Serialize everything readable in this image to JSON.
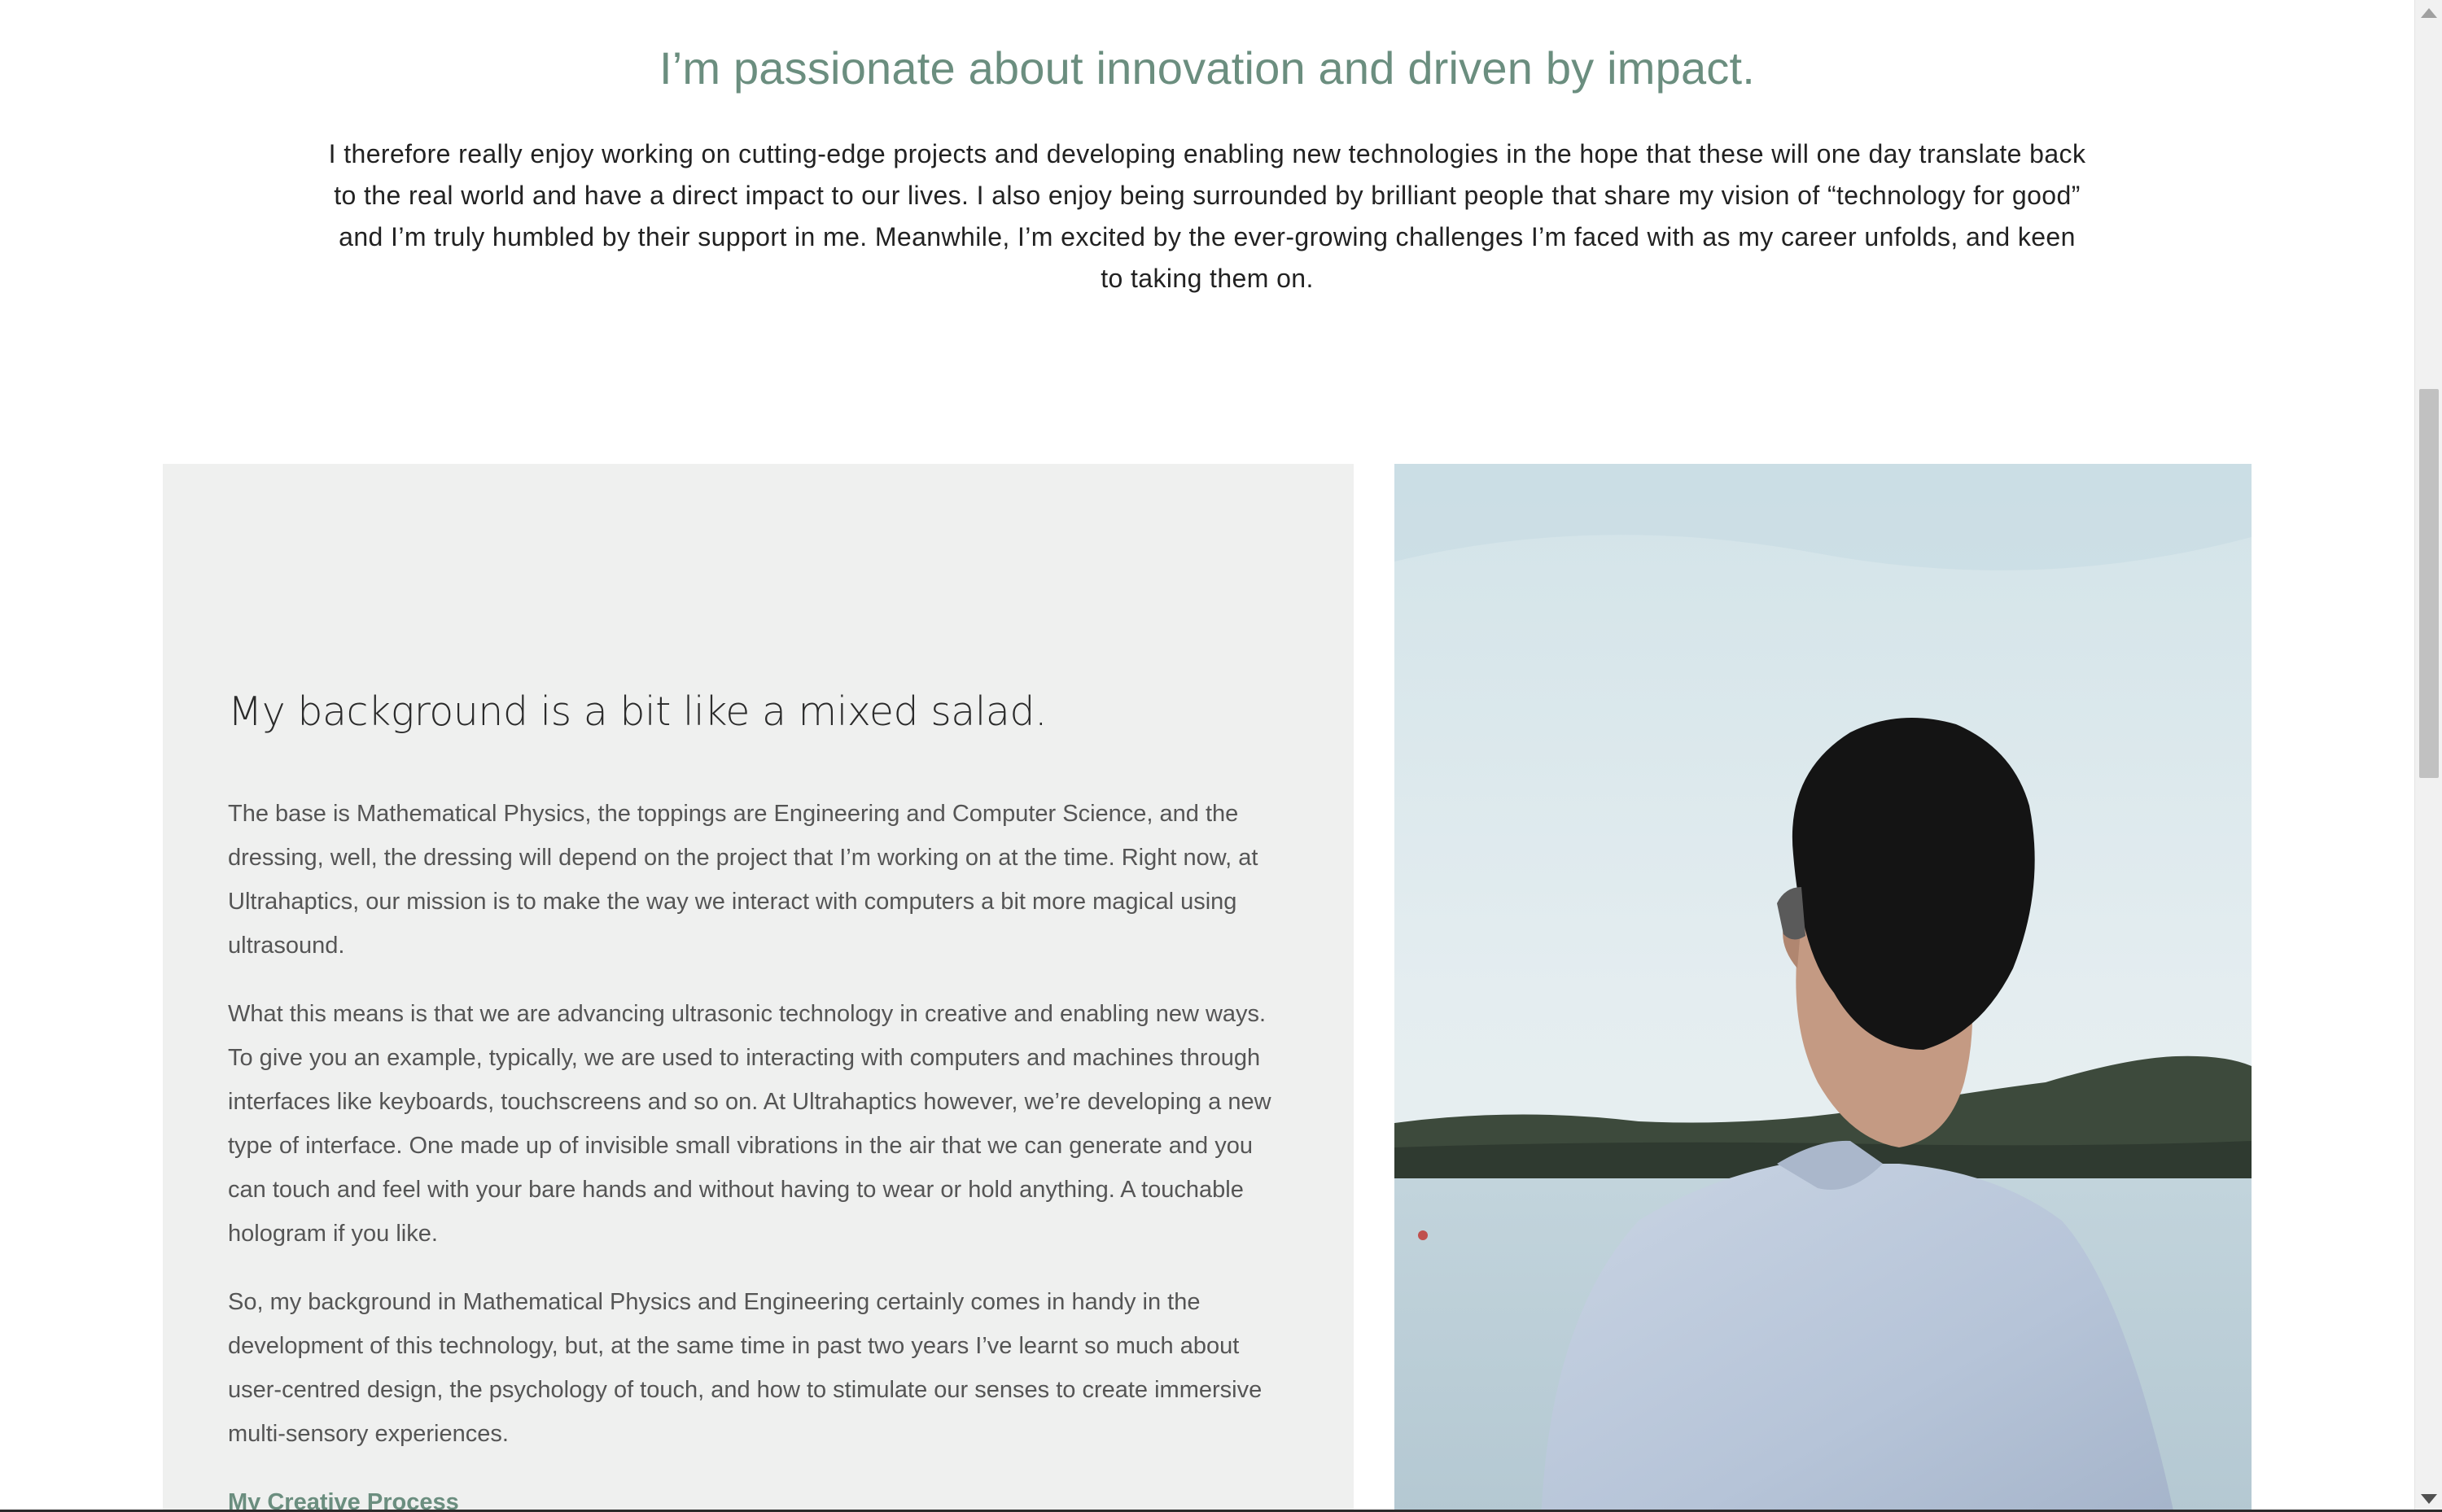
{
  "hero": {
    "title": "I’m passionate about innovation and driven by impact.",
    "body": "I therefore really enjoy working on cutting-edge projects and developing enabling new technologies in the hope that these will one day translate back to the real world and have a direct impact to our lives. I also enjoy being surrounded by brilliant people that share my vision of “technology for good” and I’m truly humbled by their support in me. Meanwhile, I’m excited by the ever-growing challenges I’m faced with as my career unfolds, and keen to taking them on."
  },
  "background": {
    "heading": "My background is a bit like a mixed salad.",
    "paragraphs": [
      "The base is Mathematical Physics, the toppings are Engineering and Computer Science, and the dressing, well, the dressing will depend on the project that I’m working on at the time. Right now, at Ultrahaptics, our mission is to make the way we interact with computers a bit more magical using ultrasound.",
      "What this means is that we are advancing ultrasonic technology in creative and enabling new ways. To give you an example, typically, we are used to interacting with computers and machines through interfaces like keyboards, touchscreens and so on. At Ultrahaptics however, we’re developing a new type of interface. One made up of invisible small vibrations in the air that we can generate and you can touch and feel with your bare hands and without having to wear or hold anything. A touchable hologram if you like.",
      "So, my background in Mathematical Physics and Engineering certainly comes in handy in the development of this technology, but, at the same time in past two years I’ve learnt so much about user-centred design, the psychology of touch, and how to stimulate our senses to create immersive multi-sensory experiences."
    ],
    "link_label": "My Creative Process"
  },
  "colors": {
    "accent": "#6b8e7f",
    "panel_background": "#eff0ef",
    "body_text": "#555555"
  }
}
